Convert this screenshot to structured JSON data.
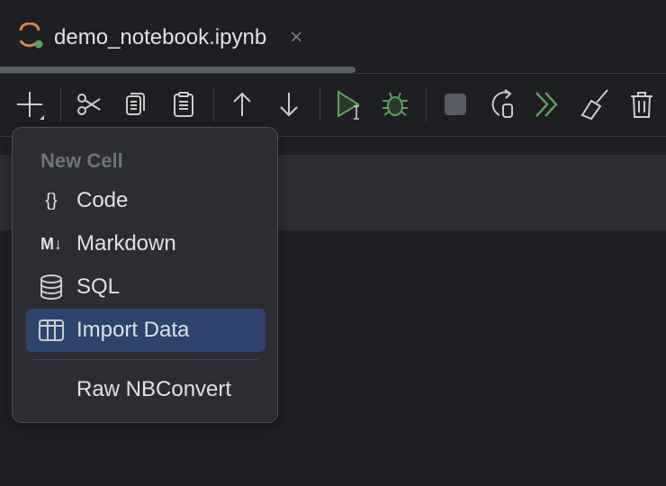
{
  "tab": {
    "title": "demo_notebook.ipynb",
    "close": "×"
  },
  "toolbar": {
    "buttons": [
      "add-cell",
      "cut",
      "copy",
      "paste",
      "move-up",
      "move-down",
      "run",
      "debug",
      "stop",
      "restart",
      "run-all",
      "clear-outputs",
      "delete"
    ]
  },
  "menu": {
    "header": "New Cell",
    "items": [
      {
        "label": "Code",
        "icon": "{}"
      },
      {
        "label": "Markdown",
        "icon": "M↓"
      },
      {
        "label": "SQL"
      },
      {
        "label": "Import Data",
        "selected": true
      },
      {
        "label": "Raw NBConvert"
      }
    ]
  },
  "colors": {
    "accent": "#2e436e",
    "run": "#5fa05f",
    "logo": "#e0834a"
  }
}
